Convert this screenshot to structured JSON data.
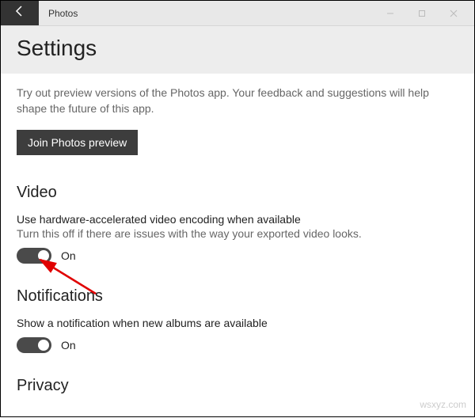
{
  "titlebar": {
    "app_name": "Photos"
  },
  "header": {
    "title": "Settings"
  },
  "preview": {
    "description": "Try out preview versions of the Photos app. Your feedback and suggestions will help shape the future of this app.",
    "button_label": "Join Photos preview"
  },
  "video": {
    "heading": "Video",
    "setting_label": "Use hardware-accelerated video encoding when available",
    "setting_hint": "Turn this off if there are issues with the way your exported video looks.",
    "toggle_state": "On"
  },
  "notifications": {
    "heading": "Notifications",
    "setting_label": "Show a notification when new albums are available",
    "toggle_state": "On"
  },
  "privacy": {
    "heading": "Privacy"
  },
  "watermark": "wsxyz.com"
}
